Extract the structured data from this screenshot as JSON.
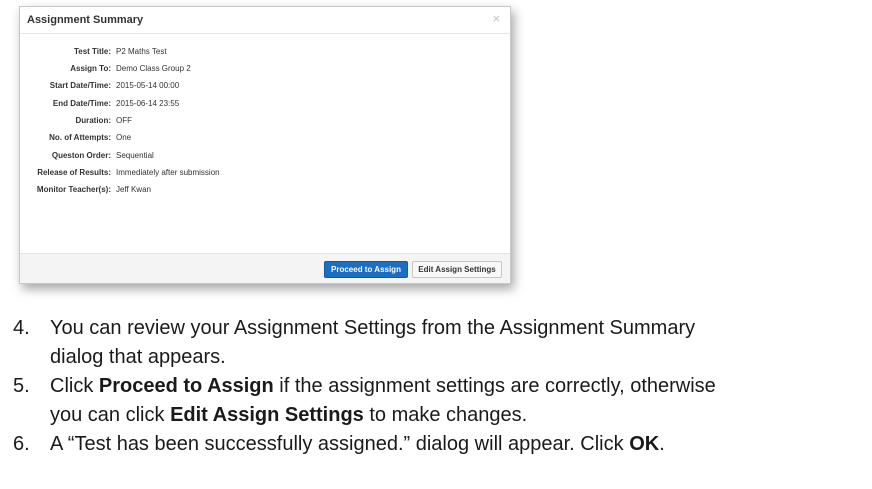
{
  "dialog": {
    "title": "Assignment Summary",
    "close_glyph": "×",
    "fields": [
      {
        "label": "Test Title:",
        "value": "P2 Maths Test"
      },
      {
        "label": "Assign To:",
        "value": "Demo Class Group 2"
      },
      {
        "label": "Start Date/Time:",
        "value": "2015-05-14 00:00"
      },
      {
        "label": "End Date/Time:",
        "value": "2015-06-14 23:55"
      },
      {
        "label": "Duration:",
        "value": "OFF"
      },
      {
        "label": "No. of Attempts:",
        "value": "One"
      },
      {
        "label": "Queston Order:",
        "value": "Sequential"
      },
      {
        "label": "Release of Results:",
        "value": "Immediately after submission"
      },
      {
        "label": "Monitor Teacher(s):",
        "value": "Jeff Kwan"
      }
    ],
    "buttons": {
      "proceed": "Proceed to Assign",
      "edit": "Edit Assign Settings"
    }
  },
  "steps": [
    {
      "number": "4.",
      "line1": "You can review your Assignment Settings from the Assignment Summary",
      "line2": "dialog that appears."
    },
    {
      "number": "5.",
      "l1a": "Click ",
      "l1b": "Proceed to Assign",
      "l1c": " if the assignment settings are correctly, otherwise",
      "l2a": "you can click ",
      "l2b": "Edit Assign Settings",
      "l2c": " to make changes."
    },
    {
      "number": "6.",
      "a": "A “Test has been successfully assigned.” dialog will appear. Click ",
      "b": "OK",
      "c": "."
    }
  ],
  "colors": {
    "primary_button": "#1a6fc4",
    "footer_bg": "#f4f4f4"
  }
}
